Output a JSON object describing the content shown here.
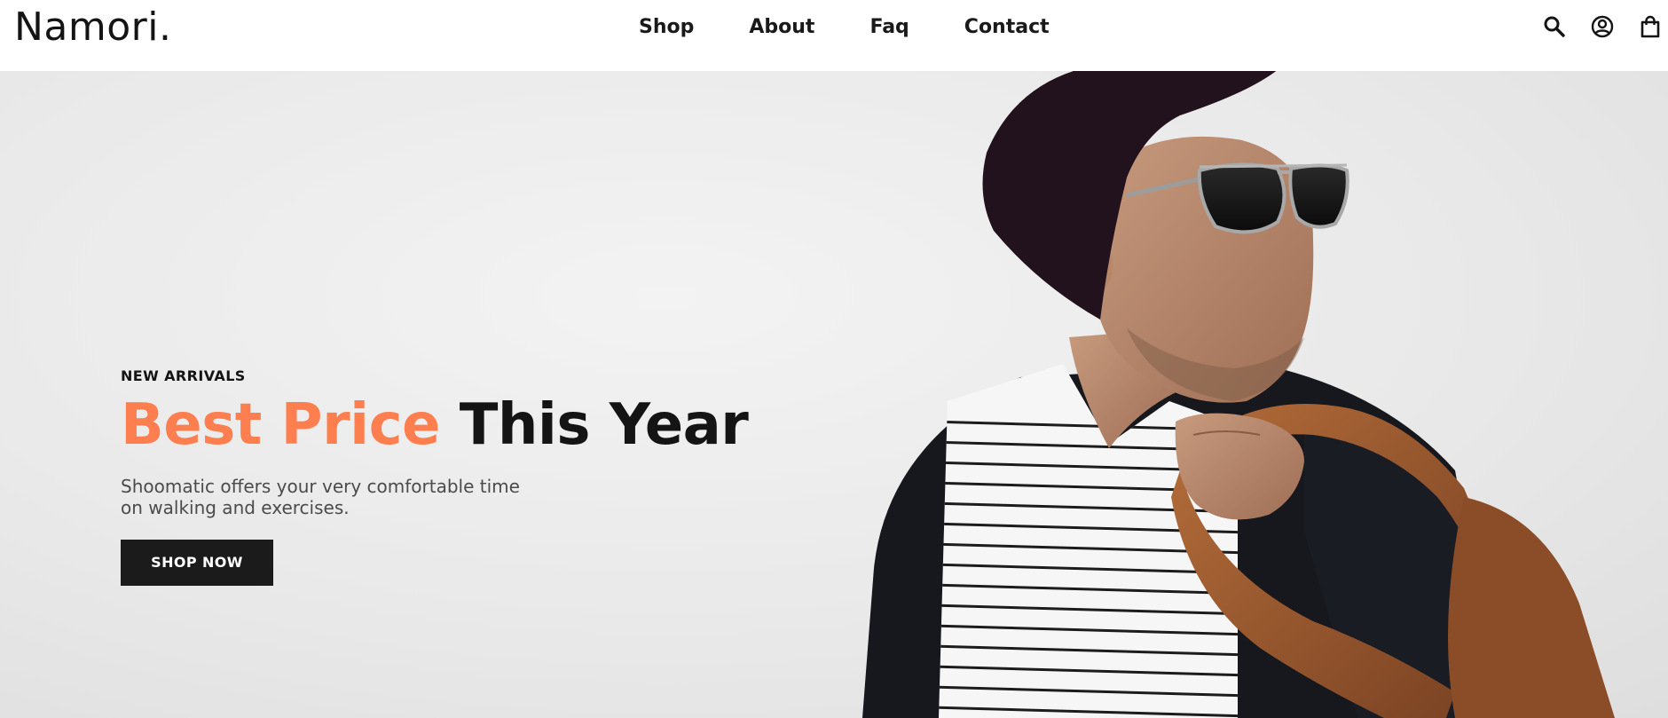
{
  "brand": {
    "logo": "Namori."
  },
  "nav": {
    "items": [
      "Shop",
      "About",
      "Faq",
      "Contact"
    ]
  },
  "header_icons": [
    "search-icon",
    "user-icon",
    "shopping-bag-icon"
  ],
  "hero": {
    "eyebrow": "NEW ARRIVALS",
    "headline_accent": "Best Price",
    "headline_rest": "This Year",
    "description": "Shoomatic offers your very comfortable time on walking and exercises.",
    "cta_label": "SHOP NOW"
  },
  "colors": {
    "accent": "#fd7e4f",
    "text": "#141414",
    "button": "#1b1b1b",
    "background": "#e9e9e9"
  }
}
